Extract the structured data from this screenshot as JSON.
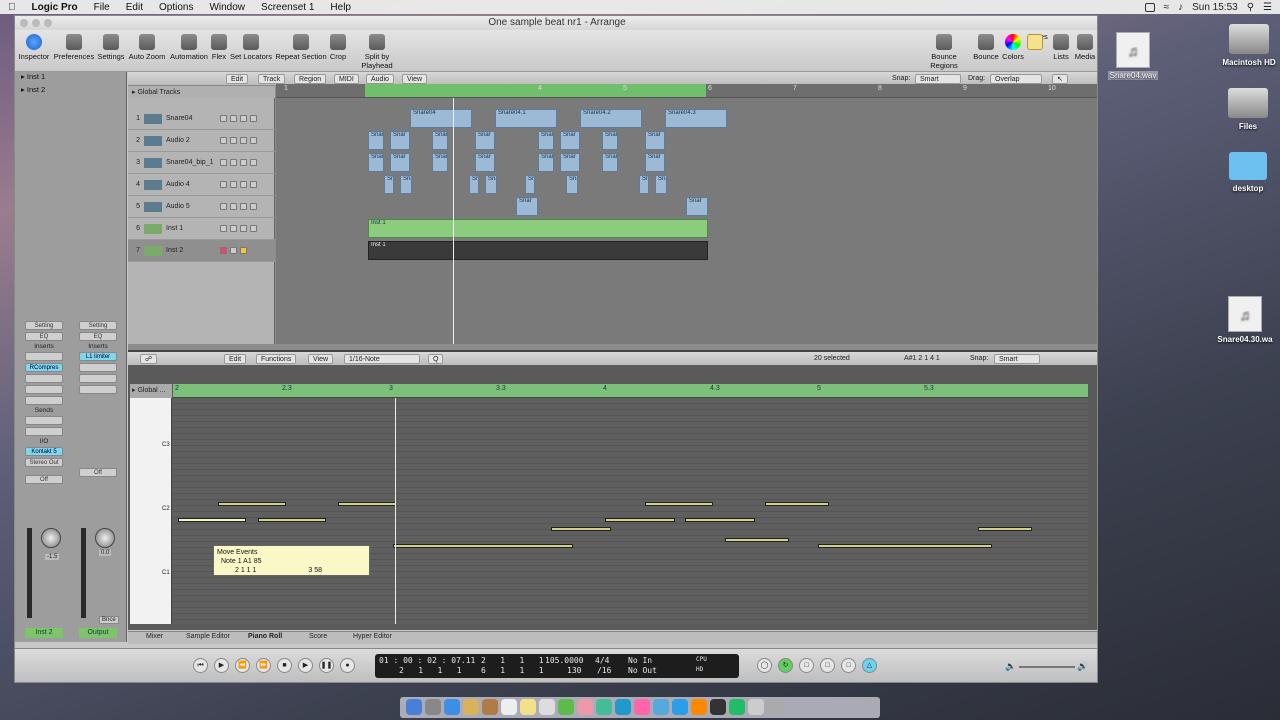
{
  "menubar": {
    "apple": "",
    "app": "Logic Pro",
    "items": [
      "File",
      "Edit",
      "Options",
      "Window",
      "Screenset 1",
      "Help"
    ],
    "clock": "Sun 15:53"
  },
  "window": {
    "title": "One sample beat nr1 - Arrange"
  },
  "toolbar": {
    "left": [
      "Inspector",
      "Preferences",
      "Settings",
      "Auto Zoom",
      "Automation",
      "Flex",
      "Set Locators",
      "Repeat Section",
      "Crop",
      "Split by Playhead"
    ],
    "right": [
      "Bounce Regions",
      "Bounce",
      "Colors",
      "Notes",
      "Lists",
      "Media"
    ]
  },
  "inspector": {
    "inst1": "Inst 1",
    "inst2": "Inst 2",
    "setting": "Setting",
    "eq": "EQ",
    "inserts": "Inserts",
    "insert_a": "RCompres",
    "insert_b": "L1 limiter",
    "sends": "Sends",
    "io": "I/O",
    "io_in": "Kontakt 5",
    "io_out": "Stereo Out",
    "off": "Off",
    "vol_a": "-1.5",
    "vol_b": "0.0",
    "bnce": "Bnce",
    "ch_a": "Inst 2",
    "ch_b": "Output"
  },
  "arrange": {
    "menus": [
      "Edit",
      "Track",
      "Region",
      "MIDI",
      "Audio",
      "View"
    ],
    "snap_label": "Snap:",
    "snap": "Smart",
    "drag_label": "Drag:",
    "drag": "Overlap",
    "global": "Global Tracks",
    "bars": [
      "1",
      "3",
      "4",
      "5",
      "6",
      "7",
      "8",
      "9",
      "10"
    ],
    "tracks": [
      {
        "n": "1",
        "name": "Snare04"
      },
      {
        "n": "2",
        "name": "Audio 2"
      },
      {
        "n": "3",
        "name": "Snare04_bip_1"
      },
      {
        "n": "4",
        "name": "Audio 4"
      },
      {
        "n": "5",
        "name": "Audio 5"
      },
      {
        "n": "6",
        "name": "Inst 1"
      },
      {
        "n": "7",
        "name": "Inst 2"
      }
    ],
    "regions_top": [
      "Snare04",
      "Snare04.1",
      "Snare04.2",
      "Snare04.3"
    ],
    "region_short": "Snar",
    "inst1": "Inst 1",
    "inst2": "Inst 1"
  },
  "pianoroll": {
    "menus": [
      "Edit",
      "Functions",
      "View"
    ],
    "quant": "1/16-Note",
    "q": "Q",
    "selected": "20 selected",
    "pos": "A#1  2 1 4 1",
    "snap_label": "Snap:",
    "snap": "Smart",
    "global": "Global ...",
    "ruler": [
      "2",
      "2.3",
      "3",
      "3.3",
      "4",
      "4.3",
      "5",
      "5.3"
    ],
    "c3": "C3",
    "c2": "C2",
    "c1": "C1",
    "tooltip": {
      "title": "Move Events",
      "line1": "Note  1   A1   85",
      "line2": "2   1   1   1",
      ".": ".   .",
      "line2b": "3   58"
    }
  },
  "tabs": [
    "Mixer",
    "Sample Editor",
    "Piano Roll",
    "Score",
    "Hyper Editor"
  ],
  "transport": {
    "time": "01 : 00 : 02 : 07.11",
    "bars": "2   1   1   1",
    "pos_a": "2   1   1   1",
    "pos_b": "6   1   1   1",
    "tempo": "105.0000",
    "tempo2": "130",
    "sig": "4/4",
    "div": "/16",
    "in": "No In",
    "out": "No Out",
    "cpu": "CPU",
    "hd": "HD"
  },
  "desktop": {
    "file1": "Snare04.wav",
    "hd": "Macintosh HD",
    "files": "Files",
    "desktop": "desktop",
    "file2": "Snare04.30.wa"
  }
}
